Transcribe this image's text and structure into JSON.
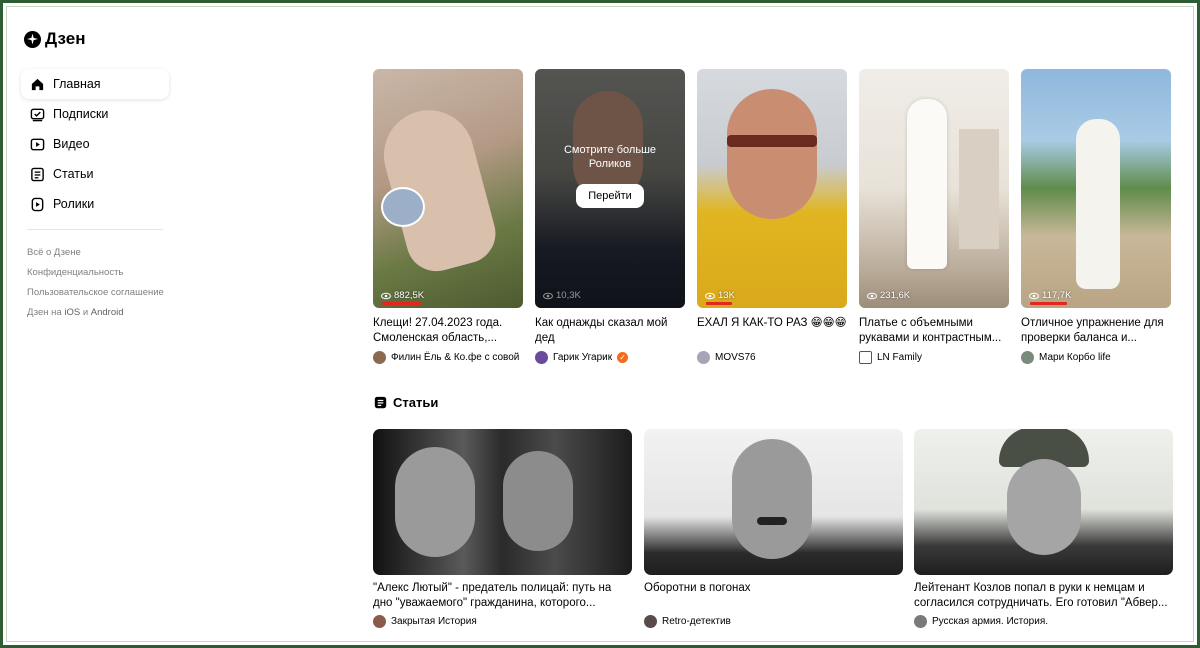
{
  "app": {
    "logo_text": "Дзен"
  },
  "sidebar": {
    "items": [
      {
        "label": "Главная",
        "icon": "home-icon"
      },
      {
        "label": "Подписки",
        "icon": "subscriptions-icon"
      },
      {
        "label": "Видео",
        "icon": "video-icon"
      },
      {
        "label": "Статьи",
        "icon": "articles-icon"
      },
      {
        "label": "Ролики",
        "icon": "shorts-icon"
      }
    ],
    "footer_links": [
      "Всё о Дзене",
      "Конфиденциальность",
      "Пользовательское соглашение"
    ],
    "apps_prefix": "Дзен на ",
    "apps_ios": "iOS",
    "apps_and": " и ",
    "apps_android": "Android"
  },
  "reels": [
    {
      "views": "882,5K",
      "title": "Клещи! 27.04.2023 года. Смоленская область,...",
      "channel": "Филин Ёль & Ко.фе с совой",
      "verified": false
    },
    {
      "views": "10,3K",
      "title": "Как однажды сказал мой дед",
      "channel": "Гарик Угарик",
      "verified": true,
      "overlay_text": "Смотрите больше Роликов",
      "overlay_button": "Перейти"
    },
    {
      "views": "13K",
      "title": "ЕХАЛ Я КАК-ТО РАЗ 😁😁😁",
      "channel": "MOVS76",
      "verified": false
    },
    {
      "views": "231,6K",
      "title": "Платье с объемными рукавами и контрастным...",
      "channel": "LN Family",
      "verified": false
    },
    {
      "views": "117,7K",
      "title": "Отличное упражнение для проверки баланса и...",
      "channel": "Мари Корбо life",
      "verified": false
    }
  ],
  "articles_section": {
    "title": "Статьи",
    "items": [
      {
        "title": "\"Алекс Лютый\" - предатель полицай: путь на дно \"уважаемого\" гражданина, которого...",
        "channel": "Закрытая История"
      },
      {
        "title": "Оборотни в погонах",
        "channel": "Retro-детектив"
      },
      {
        "title": "Лейтенант Козлов попал в руки к немцам и согласился сотрудничать. Его готовил \"Абвер...",
        "channel": "Русская армия. История."
      }
    ]
  },
  "colors": {
    "accent_underline": "#e3261e",
    "verified": "#f26b1d",
    "frame": "#2f5d33"
  }
}
